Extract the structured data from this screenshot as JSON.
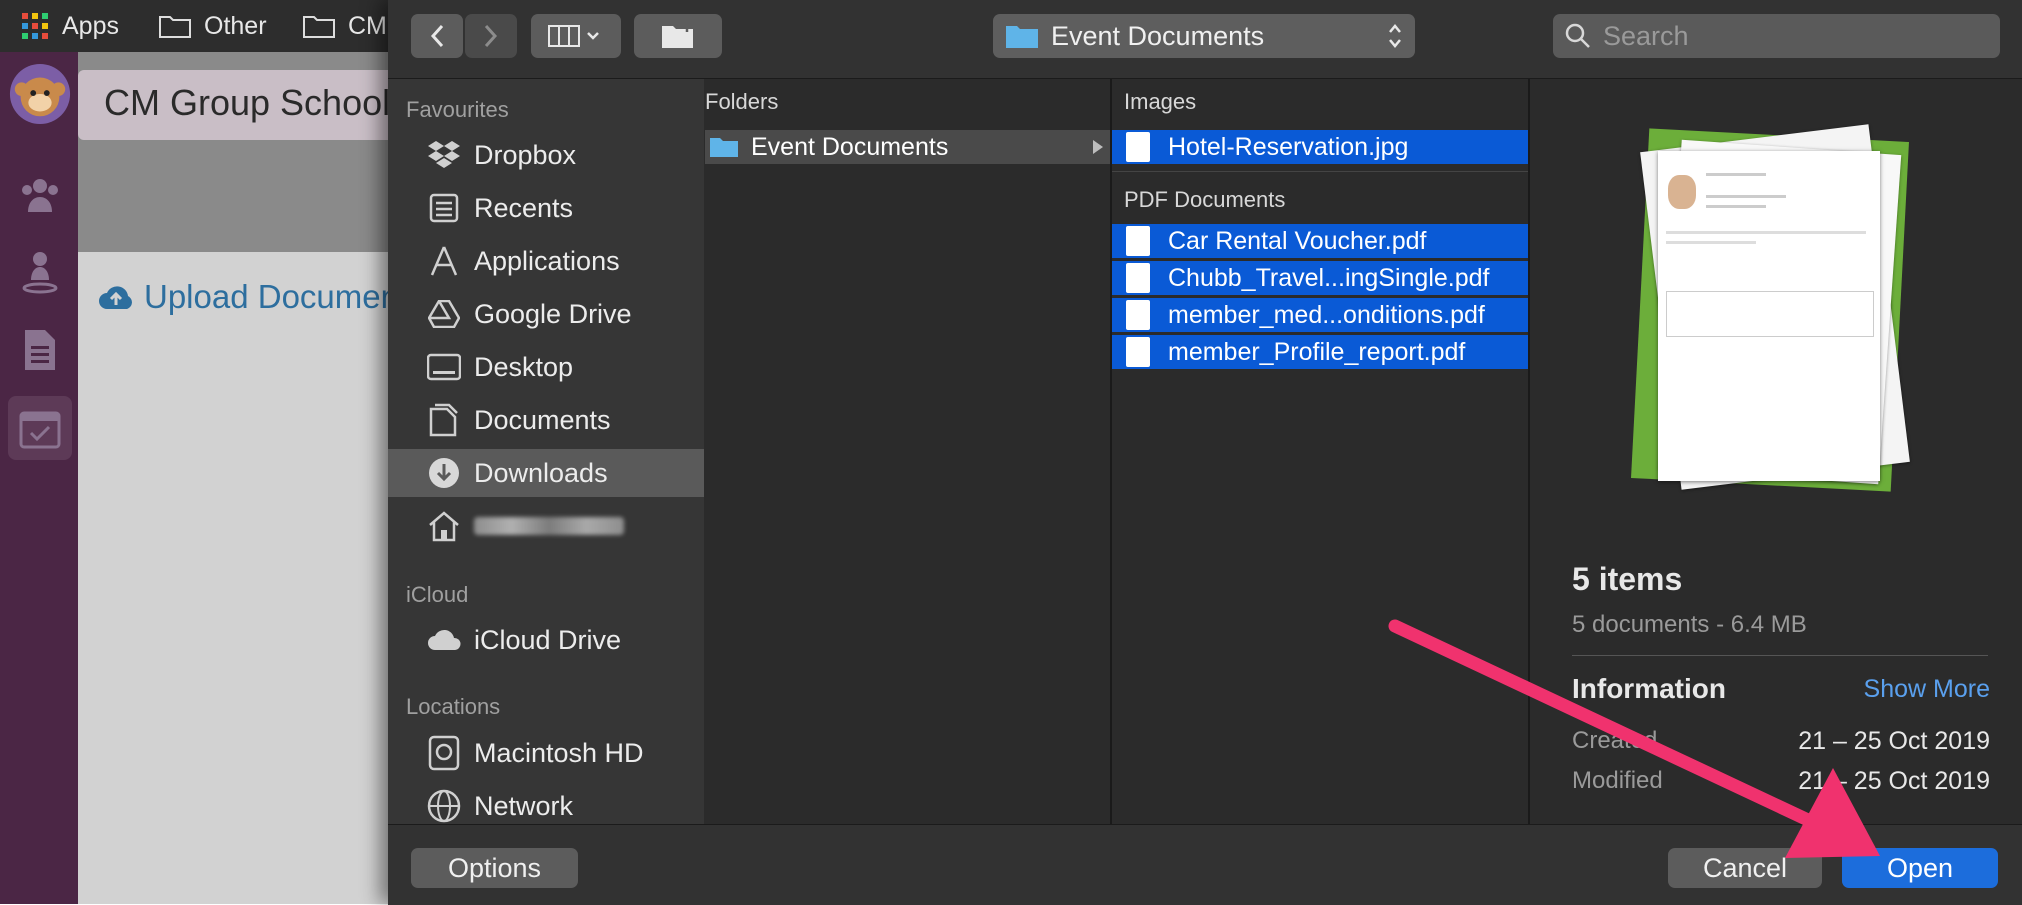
{
  "browser": {
    "bookmarks": [
      {
        "label": "Apps",
        "icon": "apps-grid-icon"
      },
      {
        "label": "Other",
        "icon": "folder-icon"
      },
      {
        "label": "CM",
        "icon": "folder-icon"
      }
    ]
  },
  "page": {
    "title": "CM Group School",
    "upload_label": "Upload Documents",
    "nav_icons": [
      "monkey-avatar-icon",
      "group-icon",
      "person-icon",
      "document-icon",
      "calendar-check-icon"
    ]
  },
  "dialog": {
    "location": "Event Documents",
    "search_placeholder": "Search",
    "sidebar": {
      "favourites_header": "Favourites",
      "favourites": [
        {
          "label": "Dropbox",
          "icon": "dropbox-icon"
        },
        {
          "label": "Recents",
          "icon": "recents-icon"
        },
        {
          "label": "Applications",
          "icon": "applications-icon"
        },
        {
          "label": "Google Drive",
          "icon": "google-drive-icon"
        },
        {
          "label": "Desktop",
          "icon": "desktop-icon"
        },
        {
          "label": "Documents",
          "icon": "documents-icon"
        },
        {
          "label": "Downloads",
          "icon": "downloads-icon",
          "selected": true
        },
        {
          "label": "",
          "icon": "home-icon",
          "blurred": true
        }
      ],
      "icloud_header": "iCloud",
      "icloud": [
        {
          "label": "iCloud Drive",
          "icon": "cloud-icon"
        }
      ],
      "locations_header": "Locations",
      "locations": [
        {
          "label": "Macintosh HD",
          "icon": "hard-drive-icon"
        },
        {
          "label": "Network",
          "icon": "network-icon"
        }
      ]
    },
    "folders_column": {
      "header": "Folders",
      "items": [
        {
          "label": "Event Documents",
          "selected": true
        }
      ]
    },
    "files_column": {
      "images_header": "Images",
      "images": [
        {
          "label": "Hotel-Reservation.jpg",
          "selected": true
        }
      ],
      "pdf_header": "PDF Documents",
      "pdfs": [
        {
          "label": "Car Rental Voucher.pdf",
          "selected": true
        },
        {
          "label": "Chubb_Travel...ingSingle.pdf",
          "selected": true
        },
        {
          "label": "member_med...onditions.pdf",
          "selected": true
        },
        {
          "label": "member_Profile_report.pdf",
          "selected": true
        }
      ]
    },
    "preview": {
      "count": "5 items",
      "summary": "5 documents - 6.4 MB",
      "info_header": "Information",
      "show_more": "Show More",
      "created_label": "Created",
      "created_value": "21 – 25 Oct 2019",
      "modified_label": "Modified",
      "modified_value": "21 – 25 Oct 2019"
    },
    "buttons": {
      "options": "Options",
      "cancel": "Cancel",
      "open": "Open"
    }
  },
  "colors": {
    "selection_blue": "#0a5ad6",
    "open_button": "#1c6ddc",
    "link_blue": "#5aa0ee",
    "annotation_arrow": "#f0326e",
    "sidebar_purple": "#4b2645"
  }
}
